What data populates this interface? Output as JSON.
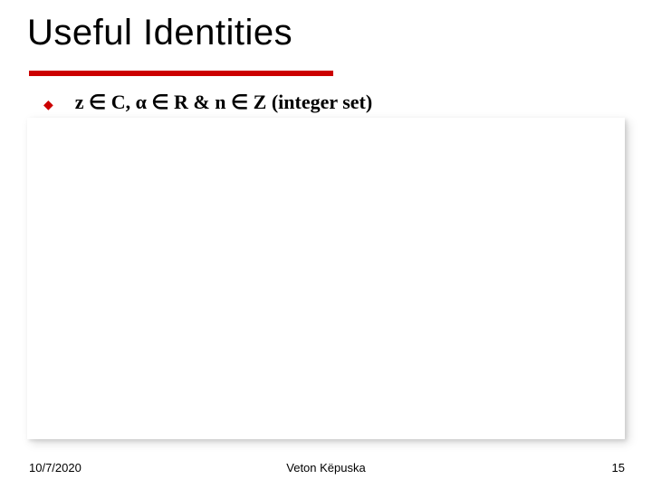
{
  "title": "Useful Identities",
  "bullet": {
    "text": "z ∈ C, α ∈ R & n ∈ Z (integer set)"
  },
  "footer": {
    "date": "10/7/2020",
    "author": "Veton Këpuska",
    "page": "15"
  },
  "colors": {
    "accent": "#cc0000"
  }
}
